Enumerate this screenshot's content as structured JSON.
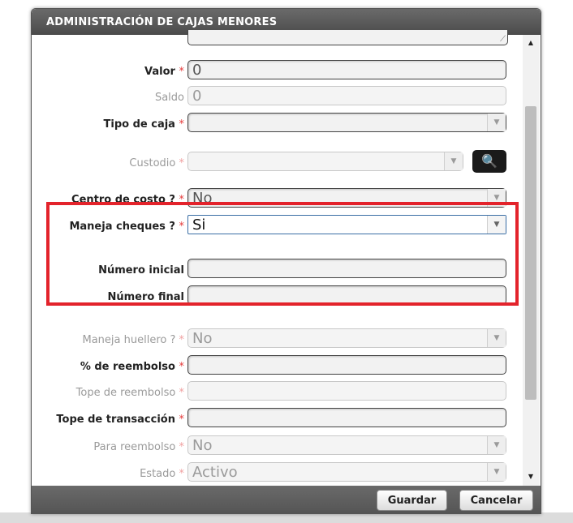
{
  "dialog": {
    "title": "ADMINISTRACIÓN DE CAJAS MENORES"
  },
  "fields": {
    "valor": {
      "label": "Valor",
      "required": "*",
      "value": "0"
    },
    "saldo": {
      "label": "Saldo",
      "value": "0"
    },
    "tipo_caja": {
      "label": "Tipo de caja",
      "required": "*",
      "value": ""
    },
    "custodio": {
      "label": "Custodio",
      "required": "*",
      "value": ""
    },
    "centro_costo": {
      "label": "Centro de costo ?",
      "required": "*",
      "value": "No"
    },
    "maneja_cheques": {
      "label": "Maneja cheques ?",
      "required": "*",
      "value": "Si"
    },
    "numero_inicial": {
      "label": "Número inicial",
      "value": ""
    },
    "numero_final": {
      "label": "Número final",
      "value": ""
    },
    "maneja_huellero": {
      "label": "Maneja huellero ?",
      "required": "*",
      "value": "No"
    },
    "pct_reembolso": {
      "label": "% de reembolso",
      "required": "*",
      "value": ""
    },
    "tope_reembolso": {
      "label": "Tope de reembolso",
      "required": "*",
      "value": ""
    },
    "tope_transaccion": {
      "label": "Tope de transacción",
      "required": "*",
      "value": ""
    },
    "para_reembolso": {
      "label": "Para reembolso",
      "required": "*",
      "value": "No"
    },
    "estado": {
      "label": "Estado",
      "required": "*",
      "value": "Activo"
    }
  },
  "buttons": {
    "save": "Guardar",
    "cancel": "Cancelar"
  },
  "icons": {
    "search": "search-icon",
    "dropdown": "chevron-down-icon",
    "resize": "resize-grip-icon"
  },
  "colors": {
    "required": "#e53a3a",
    "highlight": "#e3232b",
    "titlebar": "#555555"
  }
}
